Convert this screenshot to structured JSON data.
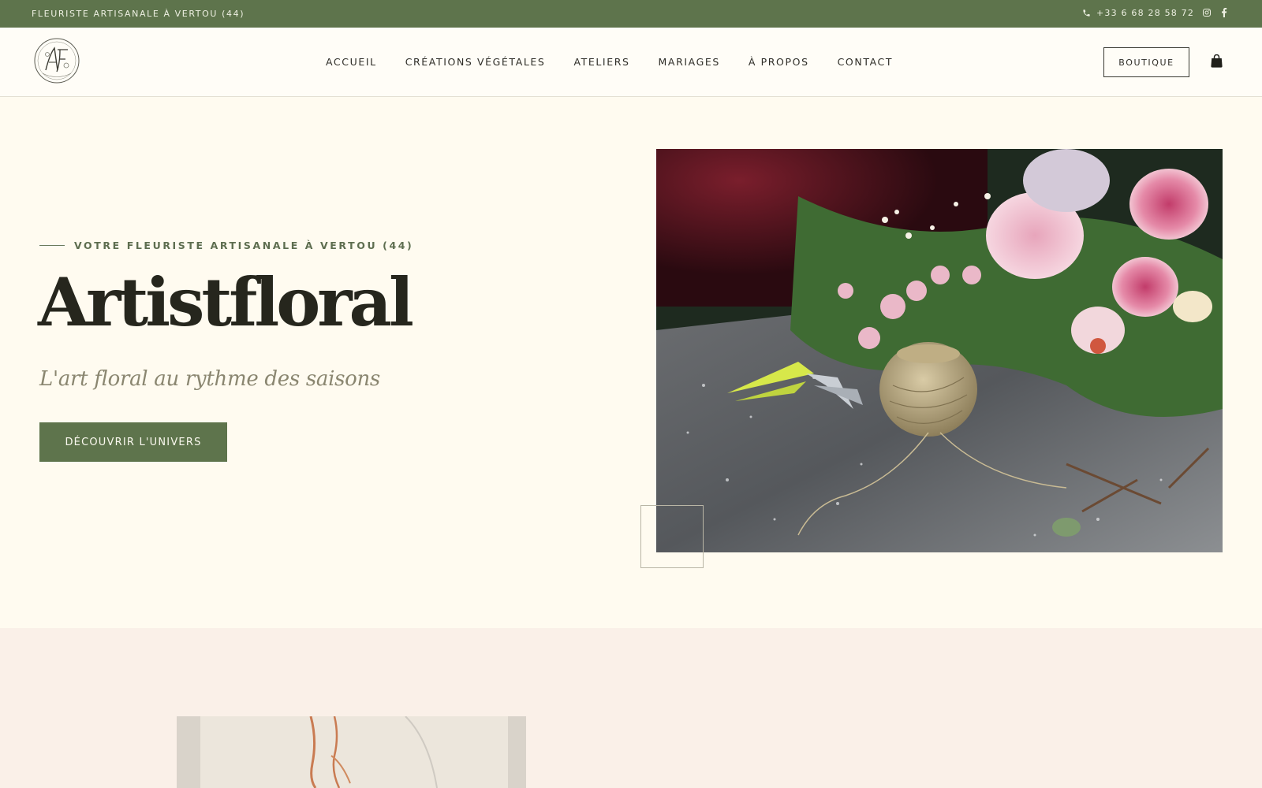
{
  "topbar": {
    "tagline": "FLEURISTE ARTISANALE À VERTOU (44)",
    "phone": "+33 6 68 28 58 72",
    "icons": [
      "phone-icon",
      "instagram-icon",
      "facebook-icon"
    ]
  },
  "header": {
    "logo_alt": "Artistfloral",
    "nav": [
      "ACCUEIL",
      "CRÉATIONS VÉGÉTALES",
      "ATELIERS",
      "MARIAGES",
      "À PROPOS",
      "CONTACT"
    ],
    "boutique_label": "BOUTIQUE",
    "cart_icon": "shopping-bag-icon"
  },
  "hero": {
    "eyebrow": "VOTRE FLEURISTE ARTISANALE À VERTOU (44)",
    "title": "Artistfloral",
    "subtitle": "L'art floral au rythme des saisons",
    "cta_label": "DÉCOUVRIR L'UNIVERS",
    "image_icon": "flowers-with-twine-and-pruning-shears-photo"
  },
  "section2": {
    "image_icon": "dried-flowers-photo"
  },
  "colors": {
    "accent_green": "#5e744c",
    "page_background": "#fffbf0",
    "section2_background": "#faf0e8",
    "title_text": "#26261d"
  }
}
